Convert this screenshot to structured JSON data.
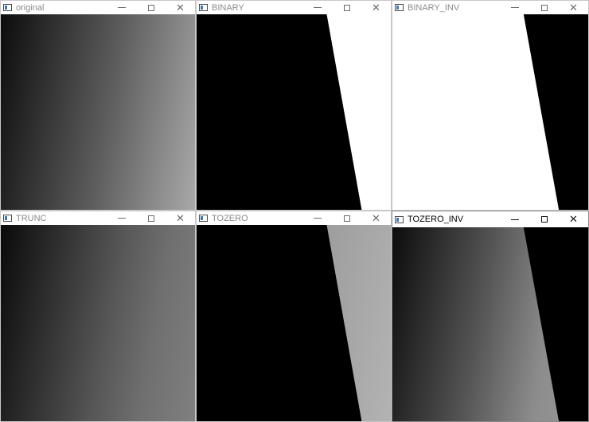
{
  "windows": [
    {
      "title": "original",
      "controls": {
        "minimize": "—",
        "close": "✕"
      }
    },
    {
      "title": "BINARY",
      "controls": {
        "minimize": "—",
        "close": "✕"
      }
    },
    {
      "title": "BINARY_INV",
      "controls": {
        "minimize": "—",
        "close": "✕"
      }
    },
    {
      "title": "TRUNC",
      "controls": {
        "minimize": "—",
        "close": "✕"
      }
    },
    {
      "title": "TOZERO",
      "controls": {
        "minimize": "—",
        "close": "✕"
      }
    },
    {
      "title": "TOZERO_INV",
      "controls": {
        "minimize": "—",
        "close": "✕"
      }
    }
  ],
  "icons": {
    "app": "opencv-window-icon",
    "minimize": "minimize-icon",
    "maximize": "maximize-icon",
    "close": "close-icon"
  },
  "colors": {
    "image_black": "#000000",
    "image_white": "#ffffff",
    "titlebar": "#ffffff"
  }
}
